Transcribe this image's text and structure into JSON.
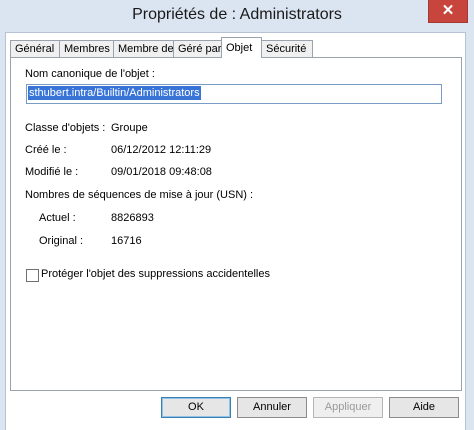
{
  "window": {
    "title": "Propriétés de : Administrators",
    "close_label": "✕"
  },
  "tabs": [
    {
      "label": "Général"
    },
    {
      "label": "Membres"
    },
    {
      "label": "Membre de"
    },
    {
      "label": "Géré par"
    },
    {
      "label": "Objet",
      "active": true
    },
    {
      "label": "Sécurité"
    }
  ],
  "object": {
    "canonical_label": "Nom canonique de l'objet :",
    "canonical_value": "sthubert.intra/Builtin/Administrators",
    "class_label": "Classe d'objets :",
    "class_value": "Groupe",
    "created_label": "Créé le :",
    "created_value": "06/12/2012 12:11:29",
    "modified_label": "Modifié le :",
    "modified_value": "09/01/2018 09:48:08",
    "usn_heading": "Nombres de séquences de mise à jour (USN) :",
    "current_label": "Actuel :",
    "current_value": "8826893",
    "original_label": "Original :",
    "original_value": "16716",
    "protect_label": "Protéger l'objet des suppressions accidentelles",
    "protect_checked": false
  },
  "buttons": {
    "ok": "OK",
    "cancel": "Annuler",
    "apply": "Appliquer",
    "help": "Aide"
  }
}
